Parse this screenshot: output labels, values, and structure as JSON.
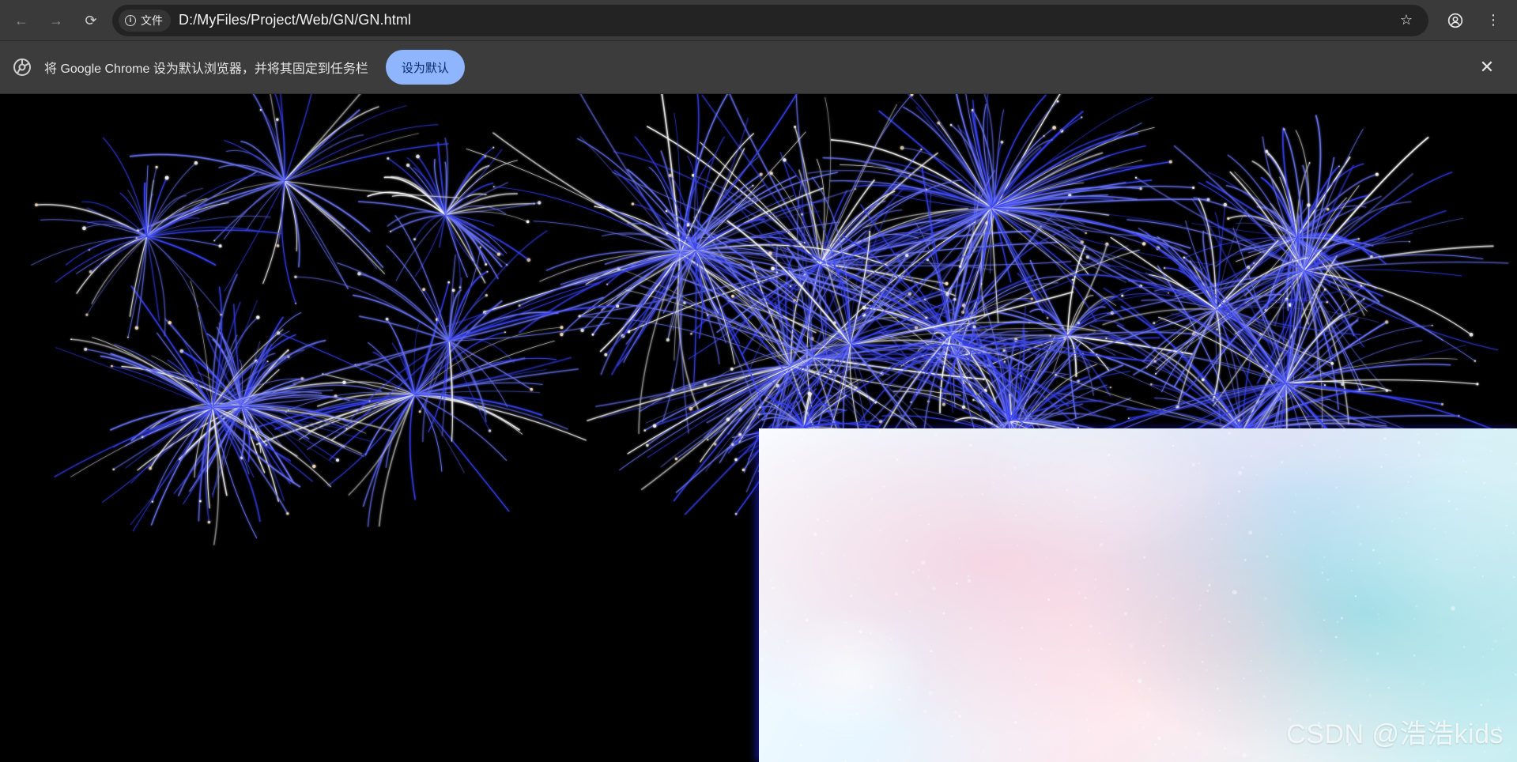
{
  "browser": {
    "address_bar": {
      "security_label": "文件",
      "url": "D:/MyFiles/Project/Web/GN/GN.html"
    },
    "icons": {
      "back": "arrow-left-icon",
      "forward": "arrow-right-icon",
      "reload": "reload-icon",
      "info": "info-icon",
      "bookmark": "star-icon",
      "profile": "profile-icon",
      "menu": "kebab-menu-icon",
      "close": "close-icon",
      "chrome_logo": "chrome-logo-icon"
    }
  },
  "banner": {
    "text": "将 Google Chrome 设为默认浏览器，并将其固定到任务栏",
    "button_label": "设为默认"
  },
  "page": {
    "watermark": "CSDN @浩浩kids"
  }
}
